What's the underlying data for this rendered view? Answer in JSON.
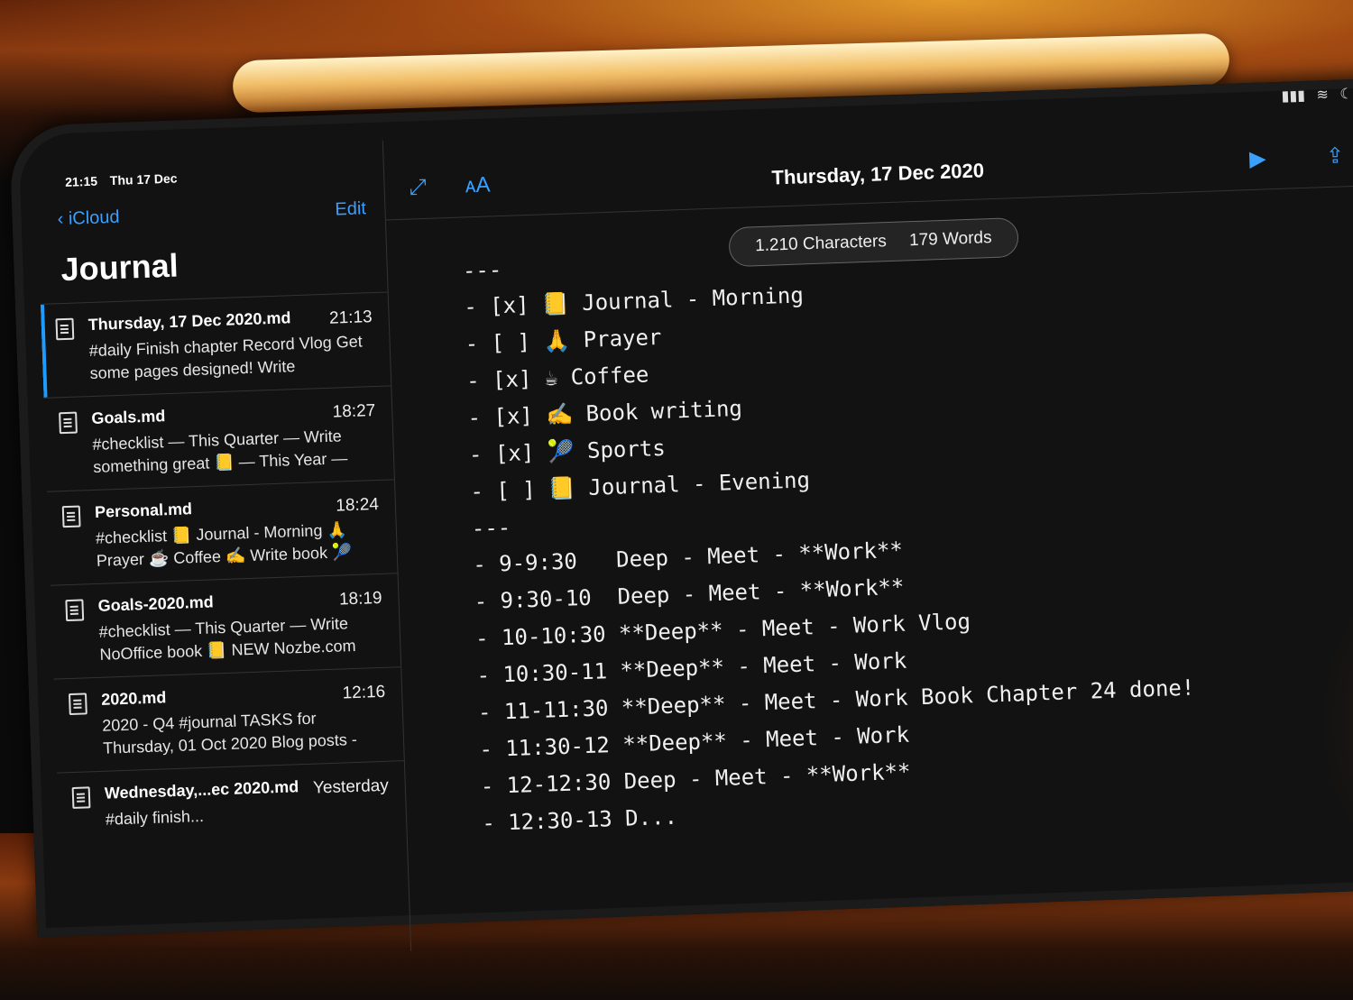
{
  "status": {
    "time": "21:15",
    "date": "Thu 17 Dec"
  },
  "nav": {
    "back_label": "iCloud",
    "edit_label": "Edit",
    "title": "Journal"
  },
  "notes": [
    {
      "name": "Thursday, 17 Dec 2020.md",
      "time": "21:13",
      "preview": "#daily Finish chapter Record Vlog Get some pages designed! Write",
      "selected": true
    },
    {
      "name": "Goals.md",
      "time": "18:27",
      "preview": "#checklist — This Quarter — Write something great 📒 — This Year —"
    },
    {
      "name": "Personal.md",
      "time": "18:24",
      "preview": "#checklist 📒 Journal - Morning 🙏 Prayer ☕ Coffee ✍️ Write book 🎾"
    },
    {
      "name": "Goals-2020.md",
      "time": "18:19",
      "preview": "#checklist — This Quarter — Write NoOffice book 📒 NEW Nozbe.com"
    },
    {
      "name": "2020.md",
      "time": "12:16",
      "preview": "2020 - Q4 #journal TASKS for Thursday, 01 Oct 2020 Blog posts -"
    },
    {
      "name": "Wednesday,...ec 2020.md",
      "time": "Yesterday",
      "preview": "#daily finish..."
    }
  ],
  "editor": {
    "title": "Thursday, 17 Dec 2020",
    "characters": "1.210 Characters",
    "words": "179 Words",
    "lines": [
      "---",
      "- [x] 📒 Journal - Morning",
      "- [ ] 🙏 Prayer",
      "- [x] ☕ Coffee",
      "- [x] ✍️ Book writing",
      "- [x] 🎾 Sports",
      "- [ ] 📒 Journal - Evening",
      "---",
      "- 9-9:30   Deep - Meet - **Work**",
      "- 9:30-10  Deep - Meet - **Work**",
      "- 10-10:30 **Deep** - Meet - Work Vlog",
      "- 10:30-11 **Deep** - Meet - Work",
      "- 11-11:30 **Deep** - Meet - Work Book Chapter 24 done!",
      "- 11:30-12 **Deep** - Meet - Work",
      "- 12-12:30 Deep - Meet - **Work**",
      "- 12:30-13 D..."
    ]
  },
  "icons": {
    "back": "chevron-left-icon",
    "expand": "expand-icon",
    "font": "font-size-icon",
    "play": "play-icon",
    "share": "share-icon",
    "doc": "document-icon"
  },
  "colors": {
    "accent": "#3aa0ff",
    "background": "#121212"
  }
}
